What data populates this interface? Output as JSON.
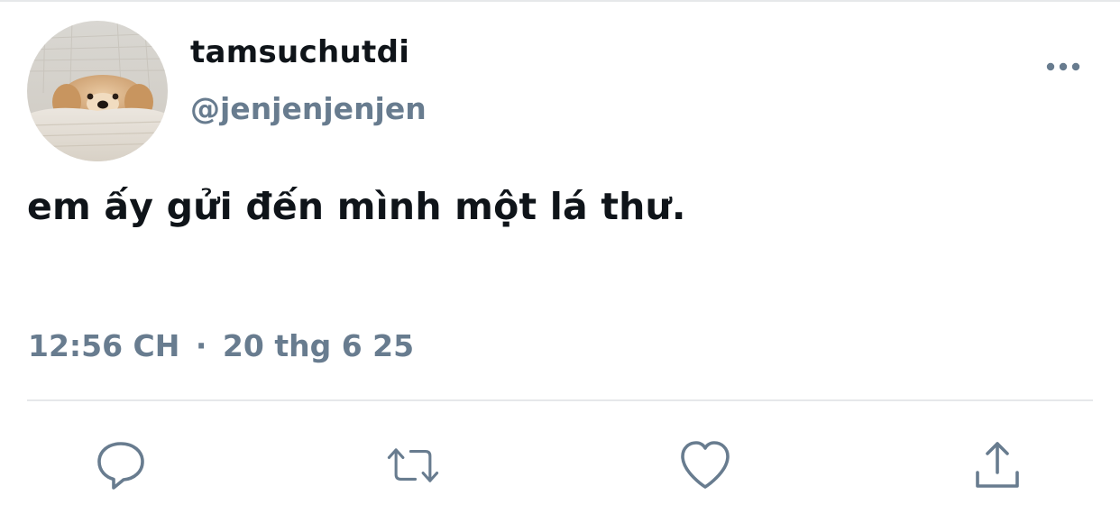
{
  "tweet": {
    "display_name": "tamsuchutdi",
    "handle": "@jenjenjenjen",
    "text": "em ấy gửi đến mình một lá thư.",
    "time": "12:56 CH",
    "separator": "·",
    "date": "20 thg 6 25"
  },
  "icons": {
    "more": "more-horizontal-icon",
    "reply": "reply-icon",
    "retweet": "retweet-icon",
    "like": "heart-icon",
    "share": "share-icon"
  },
  "colors": {
    "text_primary": "#0f1419",
    "text_secondary": "#687c8f",
    "icon": "#687c8f",
    "divider": "#e6e8ea"
  }
}
